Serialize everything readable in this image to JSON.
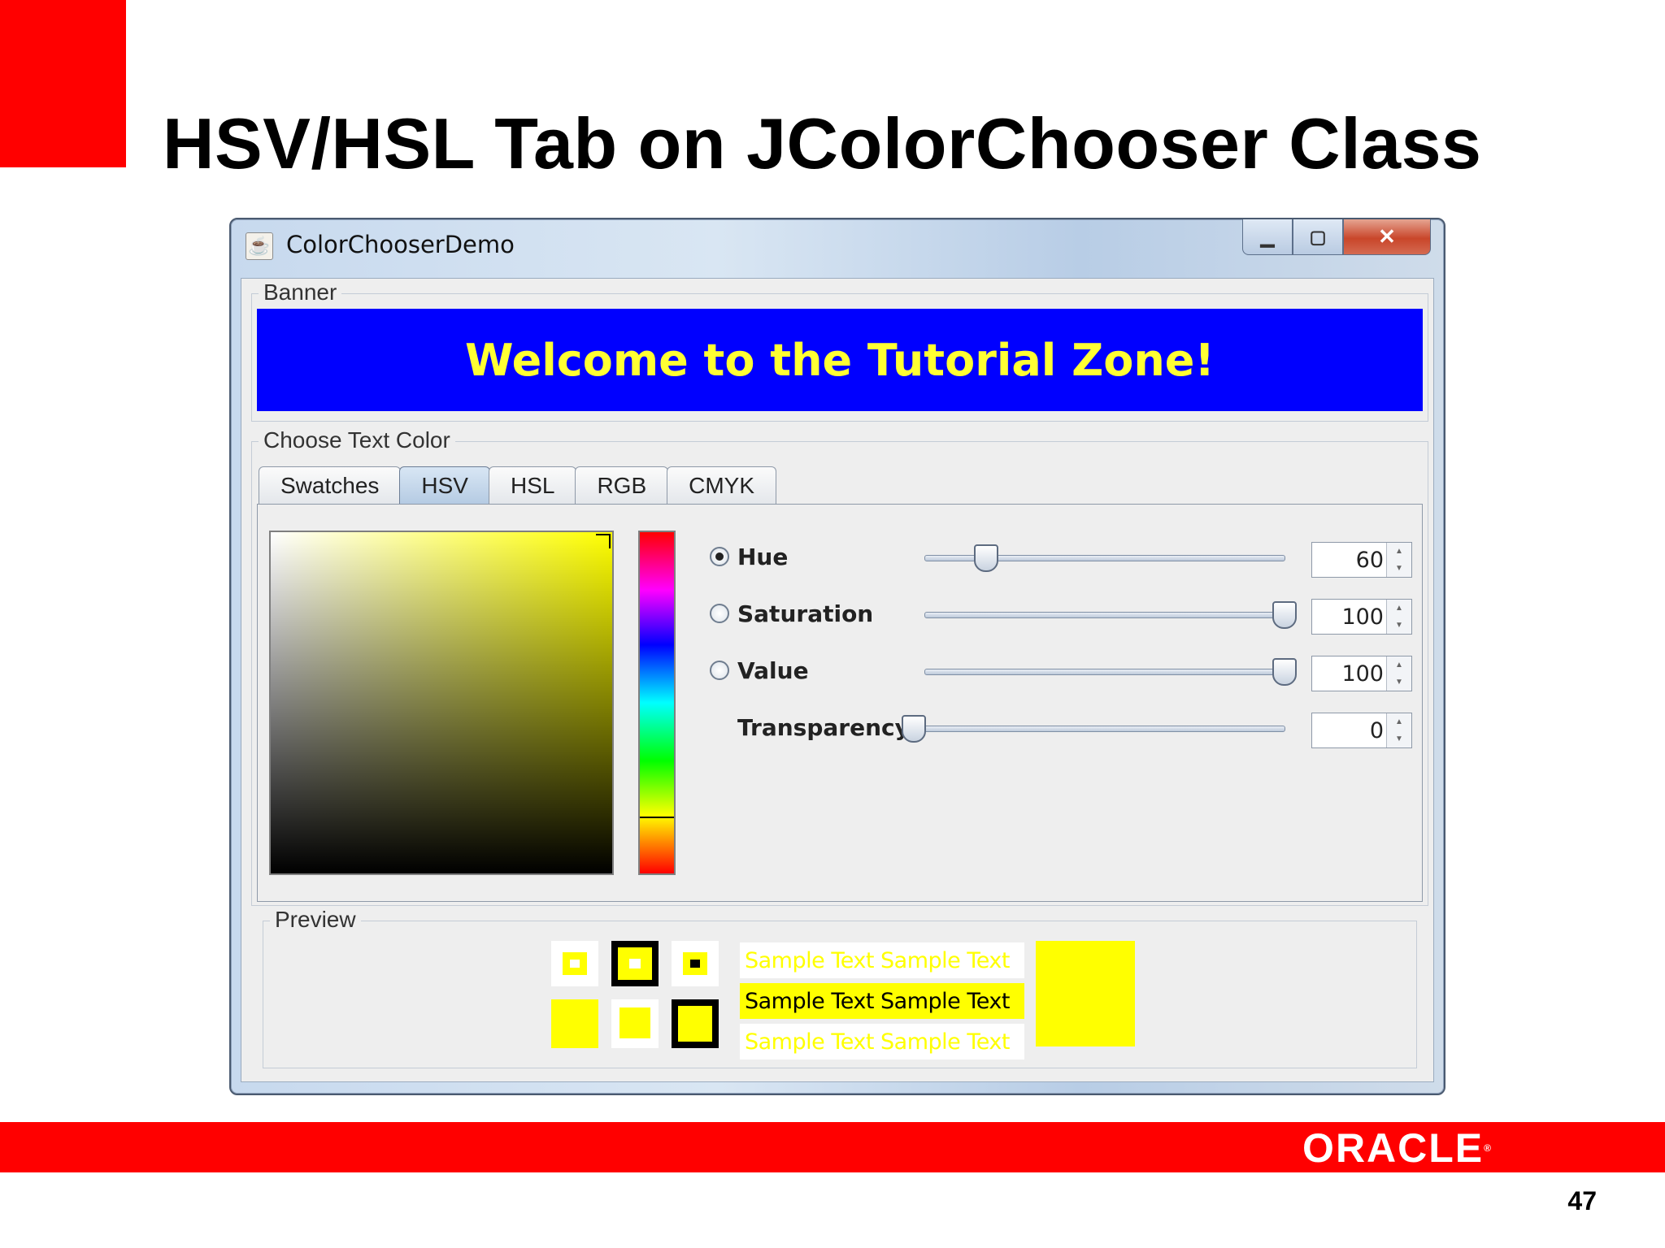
{
  "slide": {
    "title": "HSV/HSL Tab on JColorChooser Class",
    "page_number": "47",
    "brand": "ORACLE"
  },
  "window": {
    "title": "ColorChooserDemo",
    "controls": {
      "minimize_icon": "minimize-icon",
      "maximize_icon": "maximize-icon",
      "close_icon": "close-icon"
    }
  },
  "banner": {
    "group_label": "Banner",
    "text": "Welcome to the Tutorial Zone!",
    "background": "#0000ff",
    "text_color": "#ffff33"
  },
  "chooser": {
    "group_label": "Choose Text Color",
    "tabs": [
      {
        "label": "Swatches",
        "active": false
      },
      {
        "label": "HSV",
        "active": true
      },
      {
        "label": "HSL",
        "active": false
      },
      {
        "label": "RGB",
        "active": false
      },
      {
        "label": "CMYK",
        "active": false
      }
    ],
    "controls": [
      {
        "label": "Hue",
        "selected": true,
        "value": "60",
        "fraction": 0.17
      },
      {
        "label": "Saturation",
        "selected": false,
        "value": "100",
        "fraction": 1.0
      },
      {
        "label": "Value",
        "selected": false,
        "value": "100",
        "fraction": 1.0
      },
      {
        "label": "Transparency",
        "value": "0",
        "fraction": 0.0
      }
    ],
    "current_color": "#ffff00"
  },
  "preview": {
    "group_label": "Preview",
    "samples": [
      "Sample Text  Sample Text",
      "Sample Text  Sample Text",
      "Sample Text  Sample Text"
    ]
  }
}
